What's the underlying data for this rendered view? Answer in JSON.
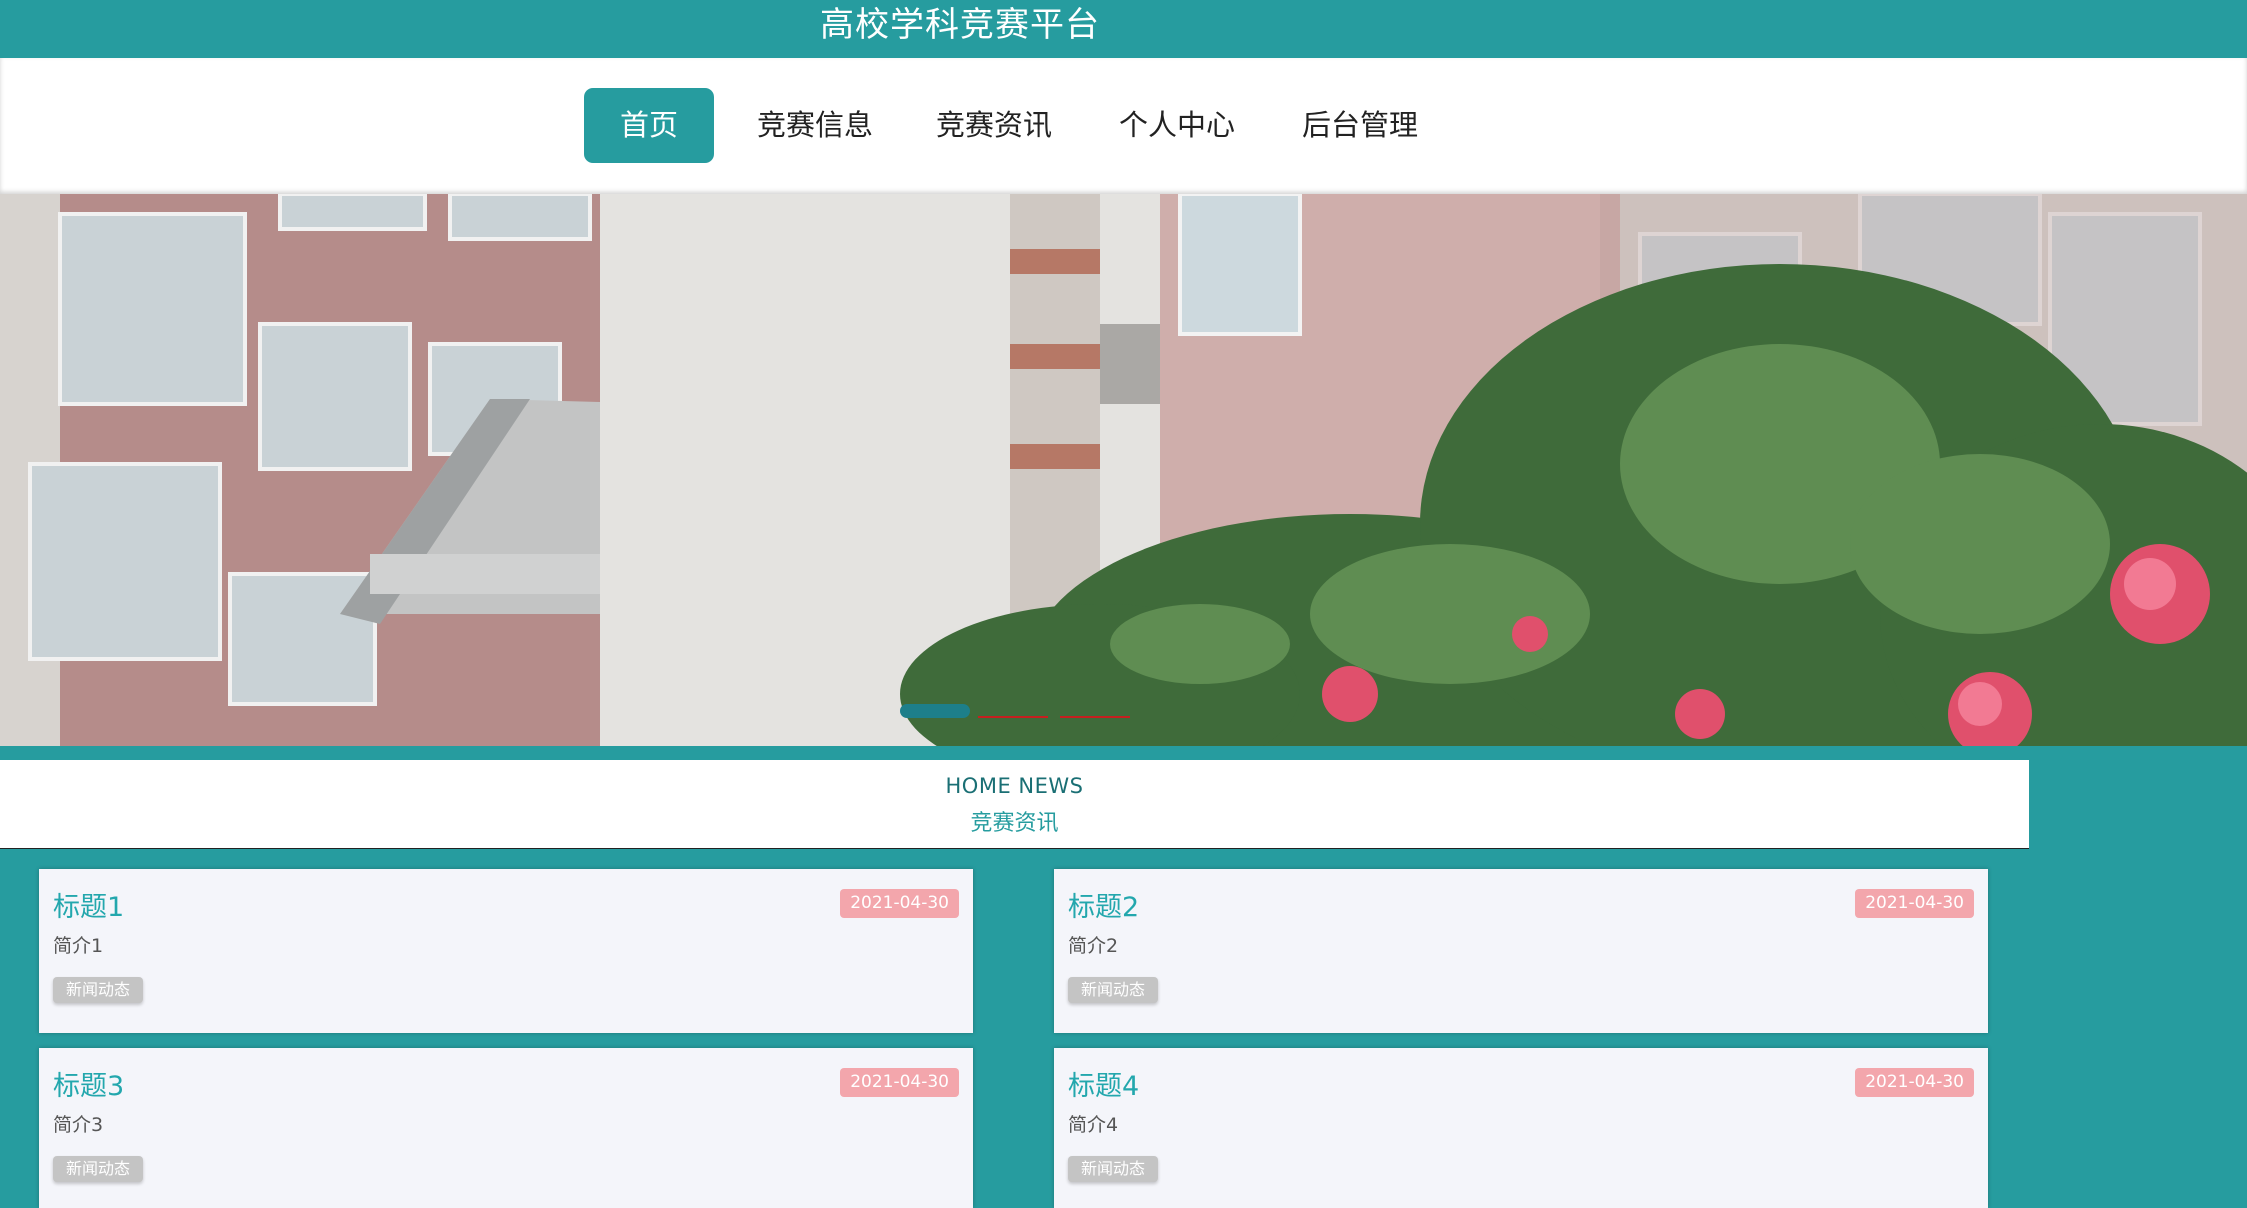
{
  "header": {
    "title": "高校学科竞赛平台"
  },
  "nav": {
    "items": [
      {
        "label": "首页",
        "active": true
      },
      {
        "label": "竞赛信息",
        "active": false
      },
      {
        "label": "竞赛资讯",
        "active": false
      },
      {
        "label": "个人中心",
        "active": false
      },
      {
        "label": "后台管理",
        "active": false
      }
    ]
  },
  "banner": {
    "current_slide": 1
  },
  "section": {
    "title_en": "HOME NEWS",
    "title_zh": "竞赛资讯"
  },
  "news": [
    {
      "title": "标题1",
      "date": "2021-04-30",
      "intro": "简介1",
      "tag": "新闻动态"
    },
    {
      "title": "标题2",
      "date": "2021-04-30",
      "intro": "简介2",
      "tag": "新闻动态"
    },
    {
      "title": "标题3",
      "date": "2021-04-30",
      "intro": "简介3",
      "tag": "新闻动态"
    },
    {
      "title": "标题4",
      "date": "2021-04-30",
      "intro": "简介4",
      "tag": "新闻动态"
    }
  ],
  "colors": {
    "primary": "#269c9f",
    "date_badge": "#f3a6ac",
    "tag_badge": "#c4c4c4",
    "card_title": "#23a7ad"
  }
}
